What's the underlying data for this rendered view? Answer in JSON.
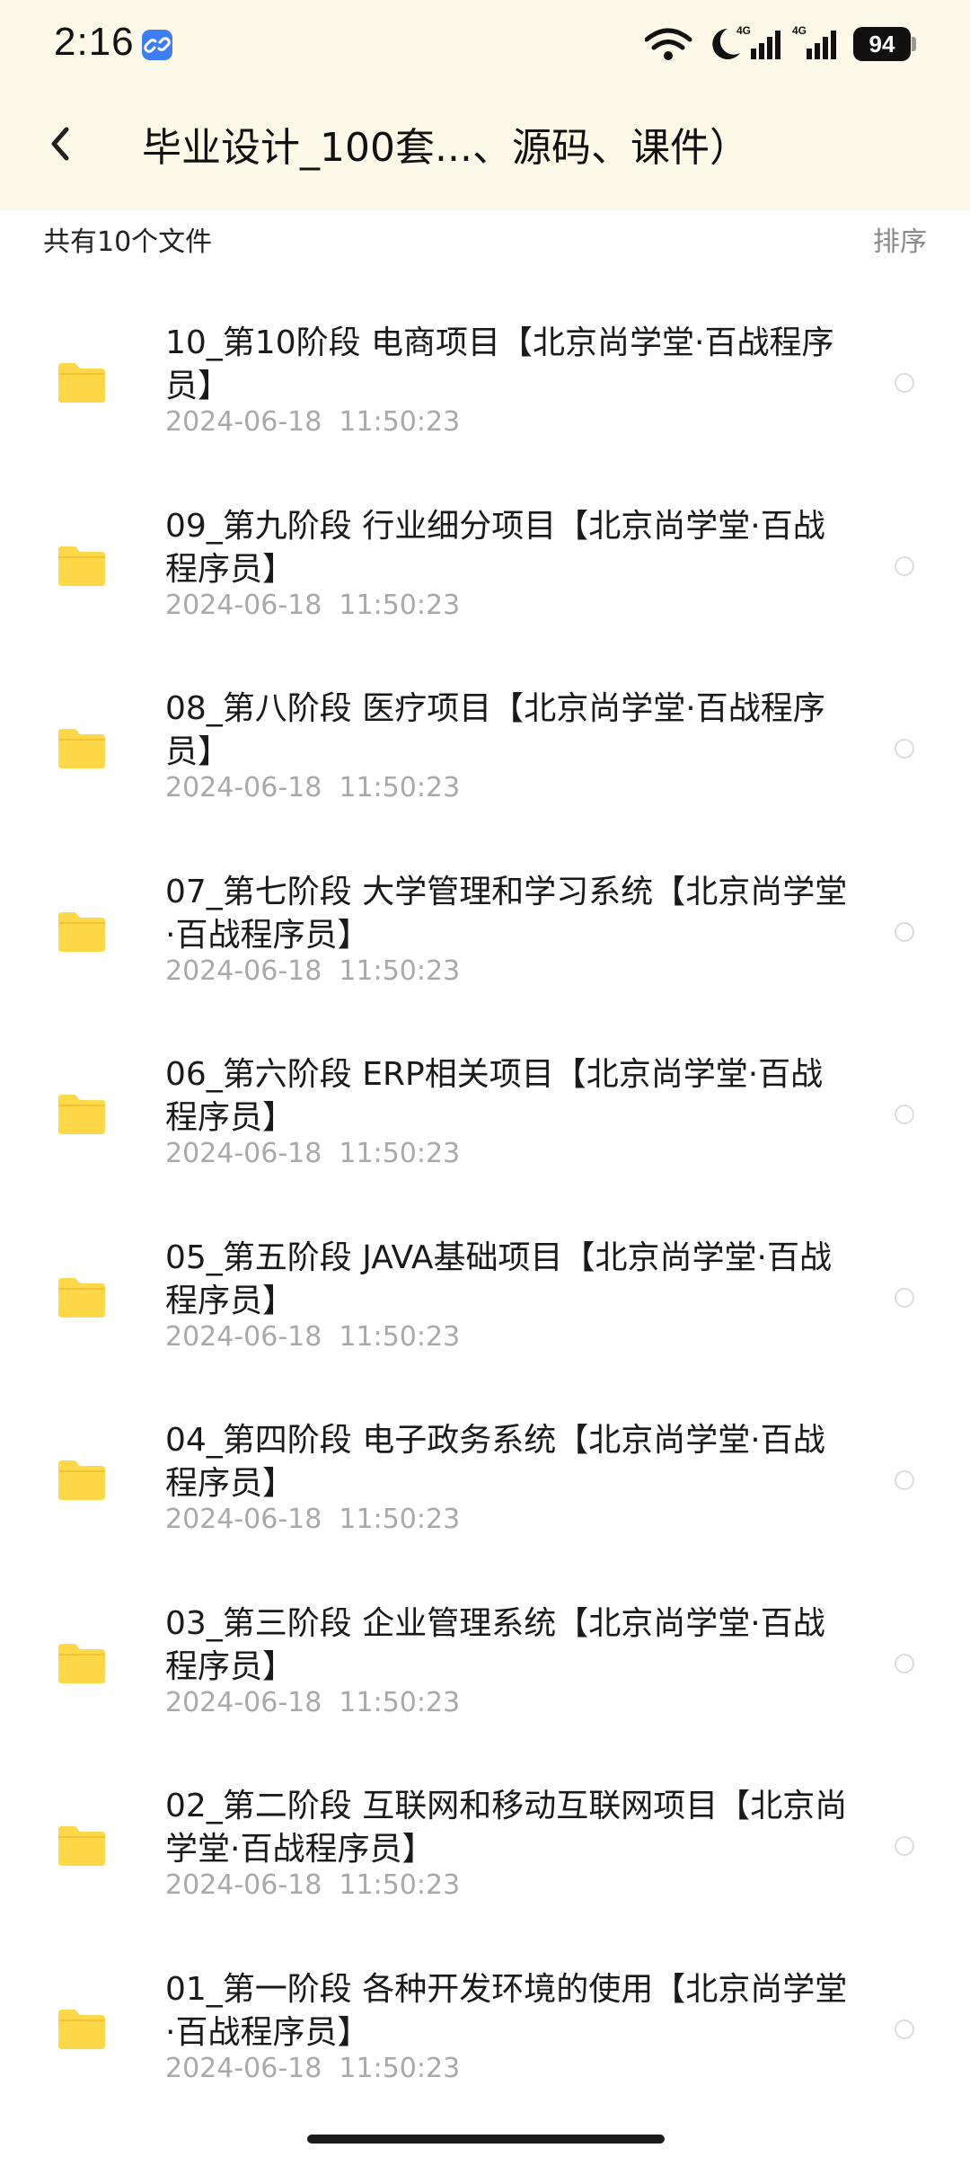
{
  "status_bar": {
    "time": "2:16",
    "network_label_1": "4G",
    "network_label_2": "4G",
    "battery": "94"
  },
  "header": {
    "title": "毕业设计_100套...、源码、课件）"
  },
  "toolbar": {
    "file_count": "共有10个文件",
    "sort_label": "排序"
  },
  "files": [
    {
      "name": "10_第10阶段 电商项目【北京尚学堂·百战程序员】",
      "date": "2024-06-18  11:50:23"
    },
    {
      "name": "09_第九阶段 行业细分项目【北京尚学堂·百战程序员】",
      "date": "2024-06-18  11:50:23"
    },
    {
      "name": "08_第八阶段 医疗项目【北京尚学堂·百战程序员】",
      "date": "2024-06-18  11:50:23"
    },
    {
      "name": "07_第七阶段 大学管理和学习系统【北京尚学堂·百战程序员】",
      "date": "2024-06-18  11:50:23"
    },
    {
      "name": "06_第六阶段 ERP相关项目【北京尚学堂·百战程序员】",
      "date": "2024-06-18  11:50:23"
    },
    {
      "name": "05_第五阶段 JAVA基础项目【北京尚学堂·百战程序员】",
      "date": "2024-06-18  11:50:23"
    },
    {
      "name": "04_第四阶段 电子政务系统【北京尚学堂·百战程序员】",
      "date": "2024-06-18  11:50:23"
    },
    {
      "name": "03_第三阶段 企业管理系统【北京尚学堂·百战程序员】",
      "date": "2024-06-18  11:50:23"
    },
    {
      "name": "02_第二阶段 互联网和移动互联网项目【北京尚学堂·百战程序员】",
      "date": "2024-06-18  11:50:23"
    },
    {
      "name": "01_第一阶段 各种开发环境的使用【北京尚学堂·百战程序员】",
      "date": "2024-06-18  11:50:23"
    }
  ],
  "colors": {
    "header_bg": "#fdf9e8",
    "folder": "#ffd84a",
    "date_text": "#a9a9a9",
    "sort_text": "#8a8a8a"
  },
  "icons": {
    "back": "chevron-left-icon",
    "folder": "folder-icon",
    "select": "radio-circle-icon"
  }
}
